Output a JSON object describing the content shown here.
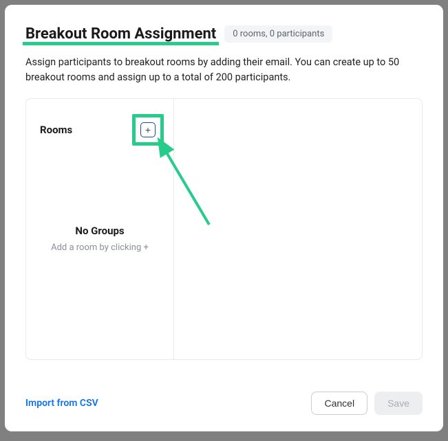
{
  "header": {
    "title": "Breakout Room Assignment",
    "badge": "0 rooms, 0 participants"
  },
  "description": "Assign participants to breakout rooms by adding their email. You can create up to 50 breakout rooms and assign up to a total of 200 participants.",
  "panel": {
    "rooms_label": "Rooms",
    "add_symbol": "+",
    "empty_title": "No Groups",
    "empty_sub": "Add a room by clicking +"
  },
  "footer": {
    "import_label": "Import from CSV",
    "cancel_label": "Cancel",
    "save_label": "Save"
  }
}
